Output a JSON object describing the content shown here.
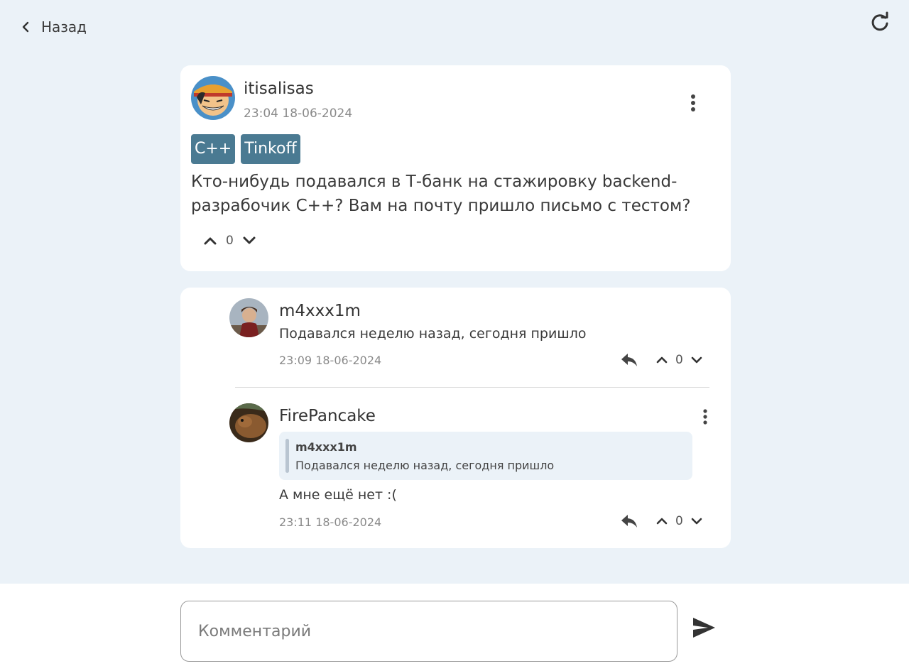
{
  "header": {
    "back_label": "Назад"
  },
  "post": {
    "author": "itisalisas",
    "date": "23:04 18-06-2024",
    "tags": [
      "C++",
      "Tinkoff"
    ],
    "text": "Кто-нибудь подавался в Т-банк на стажировку backend-разрабочик С++? Вам на почту пришло письмо с тестом?",
    "votes": "0"
  },
  "comments": [
    {
      "author": "m4xxx1m",
      "text": "Подавался неделю назад, сегодня пришло",
      "date": "23:09 18-06-2024",
      "votes": "0"
    },
    {
      "author": "FirePancake",
      "quote": {
        "author": "m4xxx1m",
        "text": "Подавался неделю назад, сегодня пришло"
      },
      "text": "А мне ещё нет :(",
      "date": "23:11 18-06-2024",
      "votes": "0"
    }
  ],
  "input": {
    "placeholder": "Комментарий"
  },
  "colors": {
    "background": "#ebf2f8",
    "tag": "#4a7a92",
    "card": "#ffffff"
  }
}
